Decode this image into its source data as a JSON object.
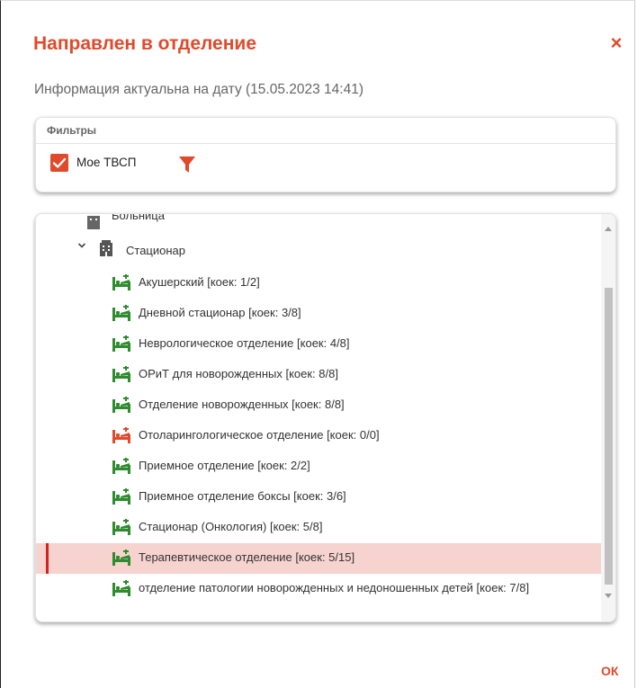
{
  "dialog": {
    "title": "Направлен в отделение",
    "close_symbol": "×",
    "info": "Информация актуальна на дату (15.05.2023 14:41)",
    "ok_label": "ОК"
  },
  "filters": {
    "header": "Фильтры",
    "checkbox_label": "Мое ТВСП",
    "checkbox_checked": true,
    "filter_icon": "filter-funnel-icon"
  },
  "tree": {
    "partial_root": "Больница",
    "group": "Стационар",
    "items": [
      {
        "label": "Акушерский [коек: 1/2]",
        "status": "available"
      },
      {
        "label": "Дневной стационар [коек: 3/8]",
        "status": "available"
      },
      {
        "label": "Неврологическое отделение [коек: 4/8]",
        "status": "available"
      },
      {
        "label": "ОРиТ для новорожденных [коек: 8/8]",
        "status": "available"
      },
      {
        "label": "Отделение новорожденных [коек: 8/8]",
        "status": "available"
      },
      {
        "label": "Отоларингологическое отделение [коек: 0/0]",
        "status": "unavailable"
      },
      {
        "label": "Приемное отделение [коек: 2/2]",
        "status": "available"
      },
      {
        "label": "Приемное отделение боксы [коек: 3/6]",
        "status": "available"
      },
      {
        "label": "Стационар (Онкология) [коек: 5/8]",
        "status": "available"
      },
      {
        "label": "Терапевтическое отделение [коек: 5/15]",
        "status": "available",
        "selected": true
      },
      {
        "label": "отделение патологии новорожденных и недоношенных детей [коек: 7/8]",
        "status": "available"
      }
    ]
  },
  "colors": {
    "accent": "#e04a2b",
    "bed_available": "#2e8b2e",
    "bed_unavailable": "#e04a2b",
    "selected_bg": "#f6d3cf"
  }
}
